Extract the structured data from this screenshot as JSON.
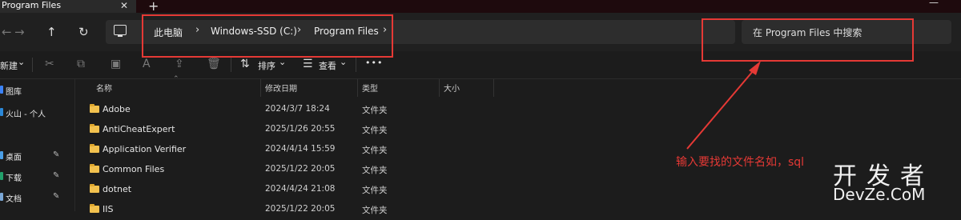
{
  "tab": {
    "title": "Program Files",
    "close": "✕",
    "new_tab": "+",
    "window_ctrl": "—"
  },
  "nav": {
    "back": "←",
    "forward": "→",
    "up": "↑",
    "refresh": "↻",
    "more": "›"
  },
  "address": {
    "crumbs": [
      "此电脑",
      "Windows-SSD (C:)",
      "Program Files"
    ],
    "separator": "›"
  },
  "search": {
    "placeholder": "在 Program Files 中搜索"
  },
  "toolbar": {
    "new_label": "新建",
    "new_caret": "⌄",
    "sort_label": "排序",
    "sort_caret": "⌄",
    "view_label": "查看",
    "view_caret": "⌄",
    "more": "•••"
  },
  "sidebar": {
    "items": [
      {
        "label": "图库",
        "color": "#3b82f6",
        "pinned": false
      },
      {
        "label": "火山 - 个人",
        "color": "#2b88d8",
        "pinned": false
      },
      {
        "label": "桌面",
        "color": "#4a9fe8",
        "pinned": true
      },
      {
        "label": "下载",
        "color": "#22a06b",
        "pinned": true
      },
      {
        "label": "文档",
        "color": "#7aa7d6",
        "pinned": true
      }
    ],
    "pin": "📌"
  },
  "table": {
    "headers": [
      "名称",
      "修改日期",
      "类型",
      "大小"
    ],
    "rows": [
      {
        "name": "Adobe",
        "date": "2024/3/7 18:24",
        "type": "文件夹"
      },
      {
        "name": "AntiCheatExpert",
        "date": "2025/1/26 20:55",
        "type": "文件夹"
      },
      {
        "name": "Application Verifier",
        "date": "2024/4/14 15:59",
        "type": "文件夹"
      },
      {
        "name": "Common Files",
        "date": "2025/1/22 20:05",
        "type": "文件夹"
      },
      {
        "name": "dotnet",
        "date": "2024/4/24 21:08",
        "type": "文件夹"
      },
      {
        "name": "IIS",
        "date": "2025/1/22 20:05",
        "type": "文件夹"
      }
    ]
  },
  "annotation": {
    "text": "输入要找的文件名如，sql",
    "color": "#e53935"
  },
  "watermark": {
    "top": "开发者",
    "bottom": "DevZe.CoM"
  }
}
